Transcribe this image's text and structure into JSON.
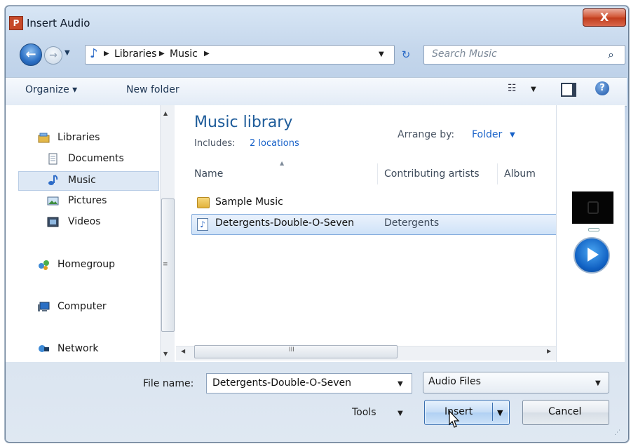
{
  "window": {
    "title": "Insert Audio",
    "app_icon_letter": "P",
    "close_symbol": "X"
  },
  "nav": {
    "back_symbol": "←",
    "forward_symbol": "→",
    "history_symbol": "▼",
    "breadcrumb": [
      "Libraries",
      "Music"
    ],
    "breadcrumb_separator": "▶",
    "dropdown_symbol": "▼",
    "refresh_symbol": "↻",
    "search_placeholder": "Search Music",
    "search_icon": "⌕"
  },
  "toolbar": {
    "organize_label": "Organize ▾",
    "new_folder_label": "New folder",
    "views_symbol": "☷",
    "views_caret": "▼",
    "help_symbol": "?"
  },
  "sidebar": {
    "items": [
      {
        "label": "Libraries",
        "icon": "libraries-icon"
      },
      {
        "label": "Documents",
        "icon": "documents-icon"
      },
      {
        "label": "Music",
        "icon": "music-icon"
      },
      {
        "label": "Pictures",
        "icon": "pictures-icon"
      },
      {
        "label": "Videos",
        "icon": "videos-icon"
      },
      {
        "label": "Homegroup",
        "icon": "homegroup-icon"
      },
      {
        "label": "Computer",
        "icon": "computer-icon"
      },
      {
        "label": "Network",
        "icon": "network-icon"
      }
    ],
    "selected": "Music"
  },
  "library": {
    "title": "Music library",
    "includes_label": "Includes:",
    "includes_link": "2 locations",
    "arrange_label": "Arrange by:",
    "arrange_value": "Folder",
    "arrange_caret": "▼"
  },
  "columns": [
    "Name",
    "Contributing artists",
    "Album"
  ],
  "files": [
    {
      "name": "Sample Music",
      "artist": "",
      "type": "folder"
    },
    {
      "name": "Detergents-Double-O-Seven",
      "artist": "Detergents",
      "type": "audio",
      "selected": true
    }
  ],
  "scroll": {
    "up": "▲",
    "down": "▼",
    "left": "◀",
    "right": "▶",
    "grip_v": "≡",
    "grip_h": "III"
  },
  "footer": {
    "file_name_label": "File name:",
    "file_name_value": "Detergents-Double-O-Seven",
    "file_type_value": "Audio Files",
    "tools_label": "Tools",
    "insert_label": "Insert",
    "cancel_label": "Cancel",
    "caret": "▼"
  },
  "colors": {
    "accent": "#1e5c9a",
    "link": "#1a63c9",
    "selection": "#cfe2f8",
    "close_button": "#d0502f"
  }
}
